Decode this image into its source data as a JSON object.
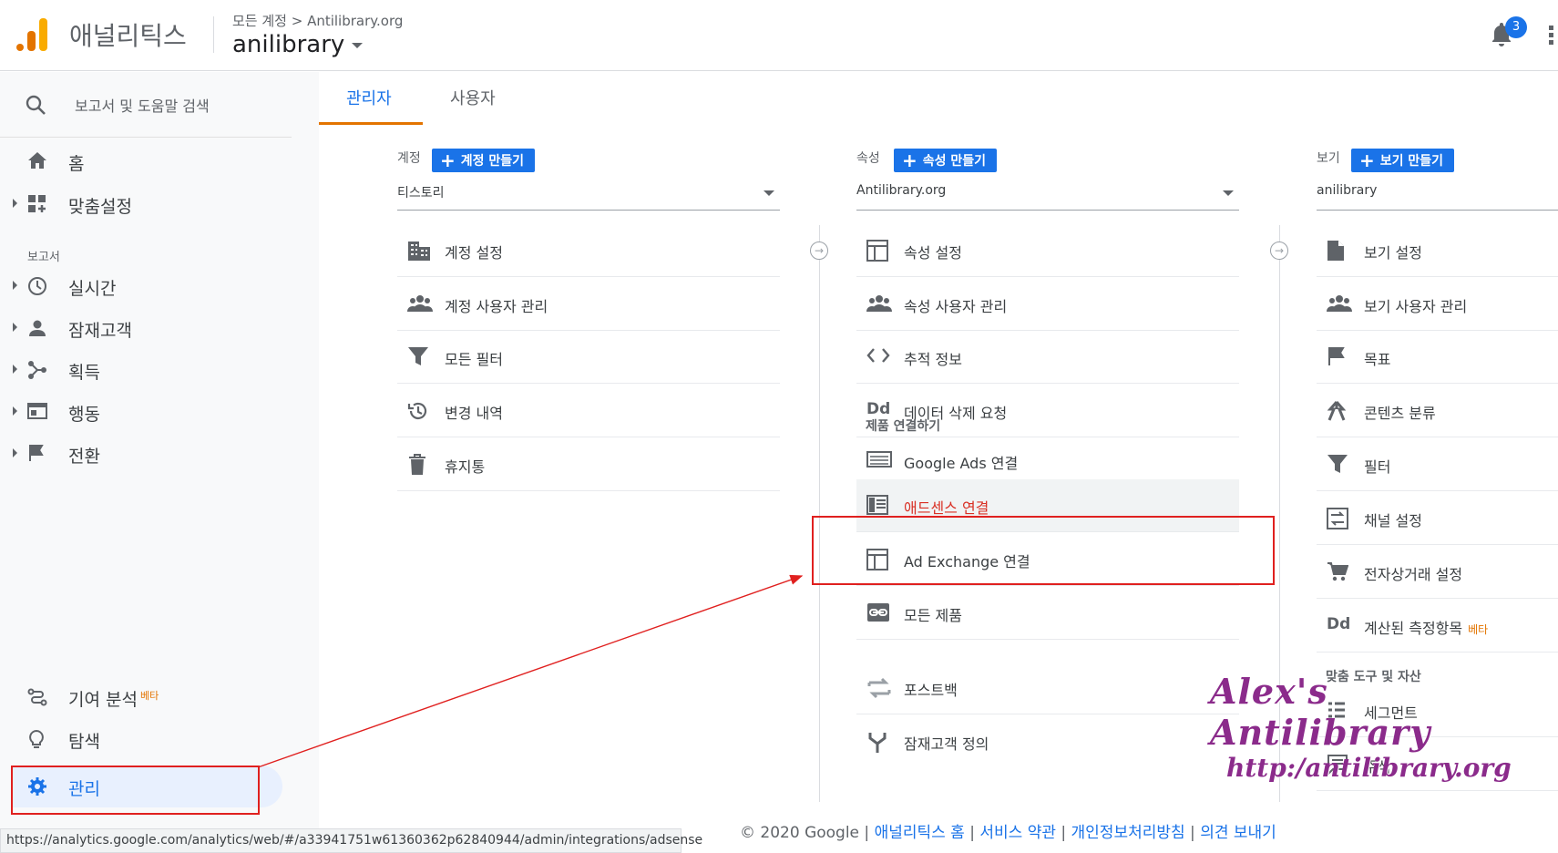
{
  "header": {
    "app_name": "애널리틱스",
    "breadcrumb": "모든 계정 > Antilibrary.org",
    "account": "anilibrary",
    "notifications": "3"
  },
  "sidebar": {
    "search_placeholder": "보고서 및 도움말 검색",
    "home": "홈",
    "customize": "맞춤설정",
    "reports_section": "보고서",
    "realtime": "실시간",
    "audience": "잠재고객",
    "acquisition": "획득",
    "behavior": "행동",
    "conversions": "전환",
    "attribution": "기여 분석",
    "attribution_beta": "베타",
    "discover": "탐색",
    "admin": "관리"
  },
  "tabs": {
    "admin": "관리자",
    "user": "사용자"
  },
  "account_col": {
    "label": "계정",
    "create": "계정 만들기",
    "selected": "티스토리",
    "items": [
      "계정 설정",
      "계정 사용자 관리",
      "모든 필터",
      "변경 내역",
      "휴지통"
    ]
  },
  "property_col": {
    "label": "속성",
    "create": "속성 만들기",
    "selected": "Antilibrary.org",
    "items": [
      "속성 설정",
      "속성 사용자 관리",
      "추적 정보",
      "데이터 삭제 요청"
    ],
    "links_section": "제품 연결하기",
    "links": [
      "Google Ads 연결",
      "애드센스 연결",
      "Ad Exchange 연결",
      "모든 제품"
    ],
    "extra": [
      "포스트백",
      "잠재고객 정의"
    ]
  },
  "view_col": {
    "label": "보기",
    "create": "보기 만들기",
    "selected": "anilibrary",
    "items": [
      "보기 설정",
      "보기 사용자 관리",
      "목표",
      "콘텐츠 분류",
      "필터",
      "채널 설정",
      "전자상거래 설정",
      "계산된 측정항목"
    ],
    "calc_beta": "베타",
    "tools_section": "맞춤 도구 및 자산",
    "tools": [
      "세그먼트",
      "주석"
    ]
  },
  "status_url": "https://analytics.google.com/analytics/web/#/a33941751w61360362p62840944/admin/integrations/adsense",
  "footer": {
    "copyright": "© 2020 Google",
    "sep": " | ",
    "links": [
      "애널리틱스 홈",
      "서비스 약관",
      "개인정보처리방침",
      "의견 보내기"
    ]
  },
  "watermark": {
    "line1": "Alex's Antilibrary",
    "line2": "http:/antilibrary.org"
  },
  "colors": {
    "accent": "#1a73e8",
    "highlight": "#d93025",
    "brand": "#e37400"
  }
}
